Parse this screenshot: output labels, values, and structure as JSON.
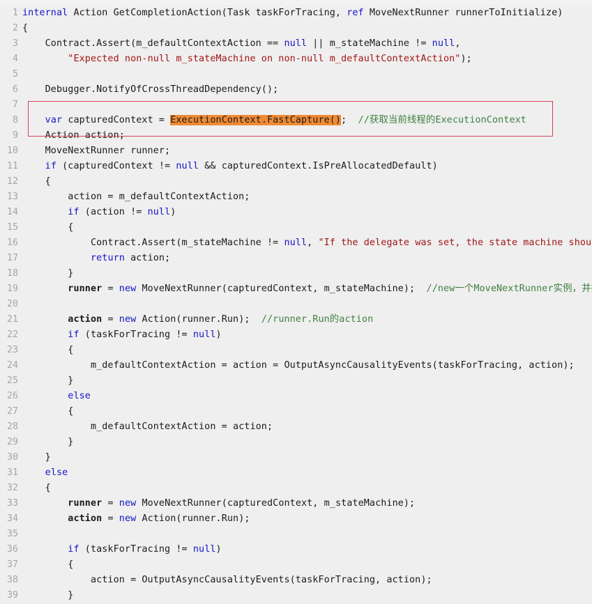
{
  "editor": {
    "background_color": "#EFEFEF",
    "gutter_color": "#9FA8A8",
    "keyword_color": "#1414C8",
    "string_color": "#A31515",
    "comment_color": "#3F7F3F",
    "highlight_color": "#F08A34",
    "annotation_box_color": "#D24356",
    "first_line_number": 1,
    "last_line_number": 39
  },
  "annotation": {
    "name": "red-rectangle-highlight",
    "covers_lines": "8-9"
  },
  "lines": [
    {
      "num": "1",
      "tokens": [
        {
          "t": "kw",
          "v": "internal"
        },
        {
          "t": "id",
          "v": " Action GetCompletionAction(Task taskForTracing, "
        },
        {
          "t": "kw",
          "v": "ref"
        },
        {
          "t": "id",
          "v": " MoveNextRunner runnerToInitialize)"
        }
      ]
    },
    {
      "num": "2",
      "tokens": [
        {
          "t": "id",
          "v": "{"
        }
      ]
    },
    {
      "num": "3",
      "tokens": [
        {
          "t": "id",
          "v": "    Contract.Assert(m_defaultContextAction == "
        },
        {
          "t": "kw",
          "v": "null"
        },
        {
          "t": "id",
          "v": " || m_stateMachine != "
        },
        {
          "t": "kw",
          "v": "null"
        },
        {
          "t": "id",
          "v": ","
        }
      ]
    },
    {
      "num": "4",
      "tokens": [
        {
          "t": "id",
          "v": "        "
        },
        {
          "t": "str",
          "v": "\"Expected non-null m_stateMachine on non-null m_defaultContextAction\""
        },
        {
          "t": "id",
          "v": ");"
        }
      ]
    },
    {
      "num": "5",
      "tokens": []
    },
    {
      "num": "6",
      "tokens": [
        {
          "t": "id",
          "v": "    Debugger.NotifyOfCrossThreadDependency();"
        }
      ]
    },
    {
      "num": "7",
      "tokens": []
    },
    {
      "num": "8",
      "tokens": [
        {
          "t": "id",
          "v": "    "
        },
        {
          "t": "kw",
          "v": "var"
        },
        {
          "t": "id",
          "v": " capturedContext = "
        },
        {
          "t": "hl",
          "v": "ExecutionContext.FastCapture()"
        },
        {
          "t": "id",
          "v": ";  "
        },
        {
          "t": "cmt",
          "v": "//获取当前线程的ExecutionContext"
        }
      ]
    },
    {
      "num": "9",
      "tokens": [
        {
          "t": "id",
          "v": "    Action action;"
        }
      ]
    },
    {
      "num": "10",
      "tokens": [
        {
          "t": "id",
          "v": "    MoveNextRunner runner;"
        }
      ]
    },
    {
      "num": "11",
      "tokens": [
        {
          "t": "id",
          "v": "    "
        },
        {
          "t": "kw",
          "v": "if"
        },
        {
          "t": "id",
          "v": " (capturedContext != "
        },
        {
          "t": "kw",
          "v": "null"
        },
        {
          "t": "id",
          "v": " && capturedContext.IsPreAllocatedDefault)"
        }
      ]
    },
    {
      "num": "12",
      "tokens": [
        {
          "t": "id",
          "v": "    {"
        }
      ]
    },
    {
      "num": "13",
      "tokens": [
        {
          "t": "id",
          "v": "        action = m_defaultContextAction;"
        }
      ]
    },
    {
      "num": "14",
      "tokens": [
        {
          "t": "id",
          "v": "        "
        },
        {
          "t": "kw",
          "v": "if"
        },
        {
          "t": "id",
          "v": " (action != "
        },
        {
          "t": "kw",
          "v": "null"
        },
        {
          "t": "id",
          "v": ")"
        }
      ]
    },
    {
      "num": "15",
      "tokens": [
        {
          "t": "id",
          "v": "        {"
        }
      ]
    },
    {
      "num": "16",
      "tokens": [
        {
          "t": "id",
          "v": "            Contract.Assert(m_stateMachine != "
        },
        {
          "t": "kw",
          "v": "null"
        },
        {
          "t": "id",
          "v": ", "
        },
        {
          "t": "str",
          "v": "\"If the delegate was set, the state machine should have"
        }
      ]
    },
    {
      "num": "17",
      "tokens": [
        {
          "t": "id",
          "v": "            "
        },
        {
          "t": "kw",
          "v": "return"
        },
        {
          "t": "id",
          "v": " action;"
        }
      ]
    },
    {
      "num": "18",
      "tokens": [
        {
          "t": "id",
          "v": "        }"
        }
      ]
    },
    {
      "num": "19",
      "tokens": [
        {
          "t": "id",
          "v": "        "
        },
        {
          "t": "bold",
          "v": "runner"
        },
        {
          "t": "id",
          "v": " = "
        },
        {
          "t": "kw",
          "v": "new"
        },
        {
          "t": "id",
          "v": " MoveNextRunner(capturedContext, m_stateMachine);  "
        },
        {
          "t": "cmt",
          "v": "//new一个MoveNextRunner实例，并把Execu"
        }
      ]
    },
    {
      "num": "20",
      "tokens": []
    },
    {
      "num": "21",
      "tokens": [
        {
          "t": "id",
          "v": "        "
        },
        {
          "t": "bold",
          "v": "action"
        },
        {
          "t": "id",
          "v": " = "
        },
        {
          "t": "kw",
          "v": "new"
        },
        {
          "t": "id",
          "v": " Action(runner.Run);  "
        },
        {
          "t": "cmt",
          "v": "//runner.Run的action"
        }
      ]
    },
    {
      "num": "22",
      "tokens": [
        {
          "t": "id",
          "v": "        "
        },
        {
          "t": "kw",
          "v": "if"
        },
        {
          "t": "id",
          "v": " (taskForTracing != "
        },
        {
          "t": "kw",
          "v": "null"
        },
        {
          "t": "id",
          "v": ")"
        }
      ]
    },
    {
      "num": "23",
      "tokens": [
        {
          "t": "id",
          "v": "        {"
        }
      ]
    },
    {
      "num": "24",
      "tokens": [
        {
          "t": "id",
          "v": "            m_defaultContextAction = action = OutputAsyncCausalityEvents(taskForTracing, action);"
        }
      ]
    },
    {
      "num": "25",
      "tokens": [
        {
          "t": "id",
          "v": "        }"
        }
      ]
    },
    {
      "num": "26",
      "tokens": [
        {
          "t": "id",
          "v": "        "
        },
        {
          "t": "kw",
          "v": "else"
        }
      ]
    },
    {
      "num": "27",
      "tokens": [
        {
          "t": "id",
          "v": "        {"
        }
      ]
    },
    {
      "num": "28",
      "tokens": [
        {
          "t": "id",
          "v": "            m_defaultContextAction = action;"
        }
      ]
    },
    {
      "num": "29",
      "tokens": [
        {
          "t": "id",
          "v": "        }"
        }
      ]
    },
    {
      "num": "30",
      "tokens": [
        {
          "t": "id",
          "v": "    }"
        }
      ]
    },
    {
      "num": "31",
      "tokens": [
        {
          "t": "id",
          "v": "    "
        },
        {
          "t": "kw",
          "v": "else"
        }
      ]
    },
    {
      "num": "32",
      "tokens": [
        {
          "t": "id",
          "v": "    {"
        }
      ]
    },
    {
      "num": "33",
      "tokens": [
        {
          "t": "id",
          "v": "        "
        },
        {
          "t": "bold",
          "v": "runner"
        },
        {
          "t": "id",
          "v": " = "
        },
        {
          "t": "kw",
          "v": "new"
        },
        {
          "t": "id",
          "v": " MoveNextRunner(capturedContext, m_stateMachine);"
        }
      ]
    },
    {
      "num": "34",
      "tokens": [
        {
          "t": "id",
          "v": "        "
        },
        {
          "t": "bold",
          "v": "action"
        },
        {
          "t": "id",
          "v": " = "
        },
        {
          "t": "kw",
          "v": "new"
        },
        {
          "t": "id",
          "v": " Action(runner.Run);"
        }
      ]
    },
    {
      "num": "35",
      "tokens": []
    },
    {
      "num": "36",
      "tokens": [
        {
          "t": "id",
          "v": "        "
        },
        {
          "t": "kw",
          "v": "if"
        },
        {
          "t": "id",
          "v": " (taskForTracing != "
        },
        {
          "t": "kw",
          "v": "null"
        },
        {
          "t": "id",
          "v": ")"
        }
      ]
    },
    {
      "num": "37",
      "tokens": [
        {
          "t": "id",
          "v": "        {"
        }
      ]
    },
    {
      "num": "38",
      "tokens": [
        {
          "t": "id",
          "v": "            action = OutputAsyncCausalityEvents(taskForTracing, action);"
        }
      ]
    },
    {
      "num": "39",
      "tokens": [
        {
          "t": "id",
          "v": "        }"
        }
      ]
    }
  ]
}
